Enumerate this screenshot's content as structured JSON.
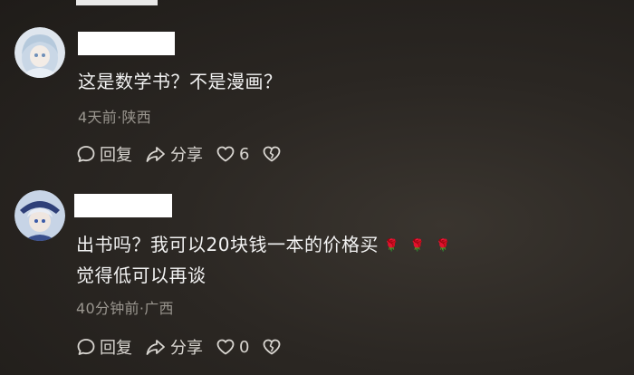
{
  "comments": [
    {
      "text": "这是数学书？不是漫画？",
      "meta": "4天前·陕西",
      "reply_label": "回复",
      "share_label": "分享",
      "like_count": "6",
      "avatar_icon": "anime-avatar-light-blue-hair"
    },
    {
      "text_before": "出书吗？我可以20块钱一本的价格买",
      "roses": [
        "🌹",
        "🌹",
        "🌹"
      ],
      "text_after": "觉得低可以再谈",
      "meta": "40分钟前·广西",
      "reply_label": "回复",
      "share_label": "分享",
      "like_count": "0",
      "avatar_icon": "anime-avatar-blue-hat"
    }
  ],
  "colors": {
    "background": "#2b2723",
    "text": "#f2f2f2",
    "meta": "#9a968f",
    "action": "#d9d6d1"
  }
}
